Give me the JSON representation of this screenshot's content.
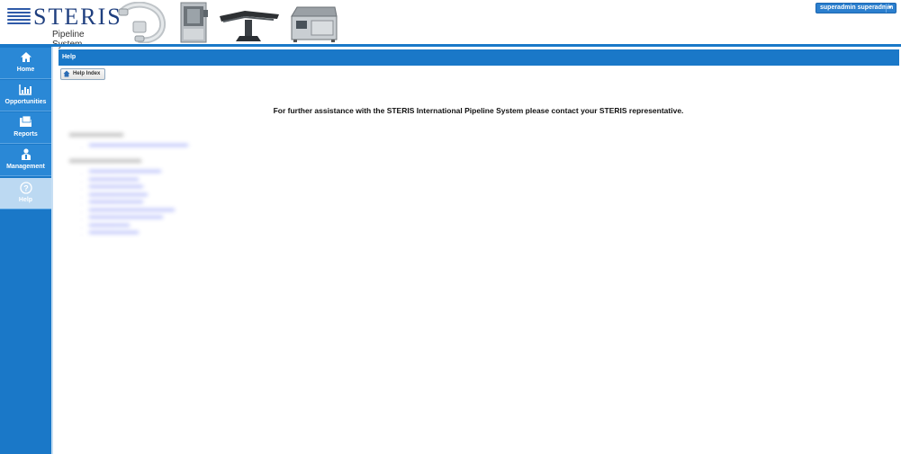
{
  "logo": {
    "name": "STERIS",
    "subtitle": "Pipeline System"
  },
  "user_menu": {
    "label": "superadmin superadmin"
  },
  "sidebar": {
    "items": [
      {
        "label": "Home",
        "icon": "home-icon"
      },
      {
        "label": "Opportunities",
        "icon": "chart-icon"
      },
      {
        "label": "Reports",
        "icon": "folder-icon"
      },
      {
        "label": "Management",
        "icon": "person-icon"
      },
      {
        "label": "Help",
        "icon": "question-icon",
        "active": true
      }
    ]
  },
  "page": {
    "title": "Help",
    "help_index_label": "Help Index",
    "assistance_text": "For further assistance with the STERIS International Pipeline System please contact your STERIS representative."
  },
  "colors": {
    "accent": "#1a78c8",
    "sidebar_active": "#bcd9f2",
    "link": "#4b5cf0"
  }
}
